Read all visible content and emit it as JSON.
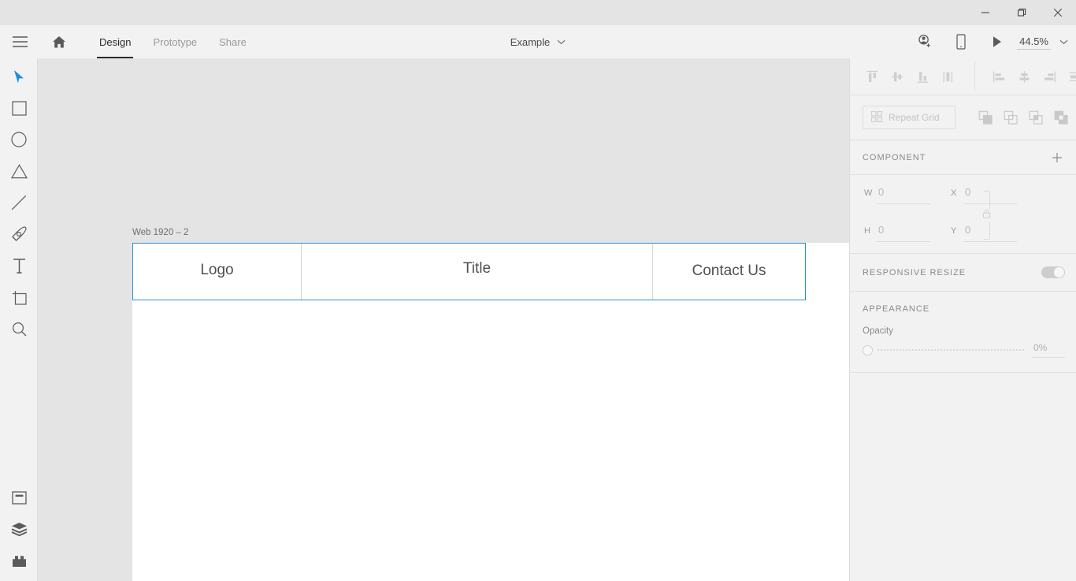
{
  "window": {
    "minimize_label": "Minimize",
    "maximize_label": "Restore",
    "close_label": "Close"
  },
  "menubar": {
    "hamburger_name": "menu",
    "home_name": "home",
    "tabs": [
      {
        "label": "Design",
        "active": true
      },
      {
        "label": "Prototype",
        "active": false
      },
      {
        "label": "Share",
        "active": false
      }
    ],
    "document_title": "Example",
    "invite_label": "Invite to document",
    "device_preview_label": "Device preview",
    "play_label": "Desktop preview",
    "zoom_value": "44.5%"
  },
  "toolbar": {
    "tools": [
      {
        "name": "select-tool",
        "label": "Select",
        "selected": true
      },
      {
        "name": "rectangle-tool",
        "label": "Rectangle",
        "selected": false
      },
      {
        "name": "ellipse-tool",
        "label": "Ellipse",
        "selected": false
      },
      {
        "name": "polygon-tool",
        "label": "Polygon",
        "selected": false
      },
      {
        "name": "line-tool",
        "label": "Line",
        "selected": false
      },
      {
        "name": "pen-tool",
        "label": "Pen",
        "selected": false
      },
      {
        "name": "text-tool",
        "label": "Text",
        "selected": false
      },
      {
        "name": "artboard-tool",
        "label": "Artboard",
        "selected": false
      },
      {
        "name": "zoom-tool",
        "label": "Zoom",
        "selected": false
      }
    ],
    "panels": [
      {
        "name": "assets-panel-button",
        "label": "Assets"
      },
      {
        "name": "layers-panel-button",
        "label": "Layers"
      },
      {
        "name": "plugins-panel-button",
        "label": "Plugins"
      }
    ]
  },
  "canvas": {
    "artboard_label": "Web 1920 – 2",
    "navbar_cells": [
      {
        "label": "Logo"
      },
      {
        "label": "Title"
      },
      {
        "label": "Contact Us"
      }
    ],
    "selection_color": "#2e90d4",
    "background_color": "#e4e4e4",
    "artboard_color": "#ffffff"
  },
  "rightpanel": {
    "align_vertical": [
      {
        "name": "align-top",
        "label": "Align top"
      },
      {
        "name": "align-vertical-center",
        "label": "Align vertical center"
      },
      {
        "name": "align-bottom",
        "label": "Align bottom"
      },
      {
        "name": "distribute-vertical",
        "label": "Distribute vertically"
      }
    ],
    "align_horizontal": [
      {
        "name": "align-left",
        "label": "Align left"
      },
      {
        "name": "align-horizontal-center",
        "label": "Align horizontal center"
      },
      {
        "name": "align-right",
        "label": "Align right"
      },
      {
        "name": "distribute-horizontal",
        "label": "Distribute horizontally"
      }
    ],
    "repeat_grid_label": "Repeat Grid",
    "boolean_ops": [
      {
        "name": "add-boolean",
        "label": "Add"
      },
      {
        "name": "subtract-boolean",
        "label": "Subtract"
      },
      {
        "name": "intersect-boolean",
        "label": "Intersect"
      },
      {
        "name": "exclude-boolean",
        "label": "Exclude overlap"
      }
    ],
    "component": {
      "title": "COMPONENT",
      "add_label": "+"
    },
    "dimensions": {
      "w_label": "W",
      "w_value": "0",
      "h_label": "H",
      "h_value": "0",
      "x_label": "X",
      "x_value": "0",
      "y_label": "Y",
      "y_value": "0",
      "lock_label": "Lock aspect ratio"
    },
    "responsive": {
      "title": "RESPONSIVE RESIZE",
      "toggle_state": "off"
    },
    "appearance": {
      "title": "APPEARANCE",
      "opacity_label": "Opacity",
      "opacity_value": "0%"
    }
  }
}
